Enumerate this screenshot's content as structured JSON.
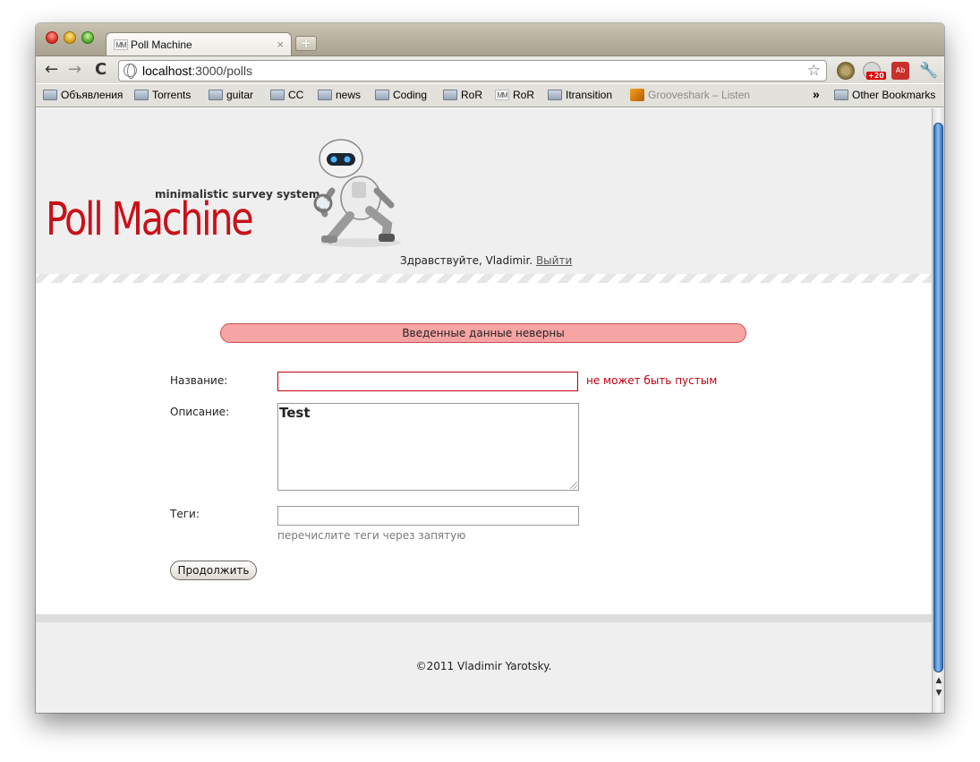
{
  "browser": {
    "tab_title": "Poll Machine",
    "tab_favicon_text": "MM",
    "tab_close_glyph": "×",
    "new_tab_glyph": "+",
    "url_host": "localhost",
    "url_path": ":3000/polls",
    "nav": {
      "back": "←",
      "forward": "→",
      "reload": "C"
    },
    "extensions": {
      "badge": "+20",
      "adblock_label": "Ab",
      "wrench_glyph": "🔧"
    },
    "bookmarks": [
      {
        "label": "Объявления",
        "icon": "folder-icon"
      },
      {
        "label": "Torrents",
        "icon": "folder-icon"
      },
      {
        "label": "guitar",
        "icon": "folder-icon"
      },
      {
        "label": "CC",
        "icon": "folder-icon"
      },
      {
        "label": "news",
        "icon": "folder-icon"
      },
      {
        "label": "Coding",
        "icon": "folder-icon"
      },
      {
        "label": "RoR",
        "icon": "folder-icon"
      },
      {
        "label": "RoR",
        "icon": "site-icon"
      },
      {
        "label": "Itransition",
        "icon": "folder-icon"
      },
      {
        "label": "Grooveshark – Listen",
        "icon": "grooveshark-icon"
      }
    ],
    "bookmarks_overflow": "»",
    "other_bookmarks": "Other Bookmarks"
  },
  "header": {
    "tagline": "minimalistic survey system",
    "logo": "Poll Machine",
    "greeting": "Здравствуйте, Vladimir.",
    "logout_label": "Выйти"
  },
  "flash": {
    "message": "Введенные данные неверны"
  },
  "form": {
    "name_label": "Название:",
    "name_value": "",
    "name_error": "не может быть пустым",
    "description_label": "Описание:",
    "description_value": "Test",
    "tags_label": "Теги:",
    "tags_value": "",
    "tags_hint": "перечислите теги через запятую",
    "submit_label": "Продолжить"
  },
  "footer": {
    "copyright": "©2011 Vladimir Yarotsky."
  },
  "colors": {
    "logo": "#c8111a",
    "flash_bg": "#f7a4a4",
    "error_text": "#c00010",
    "scroll_thumb": "#2d6fb8"
  }
}
